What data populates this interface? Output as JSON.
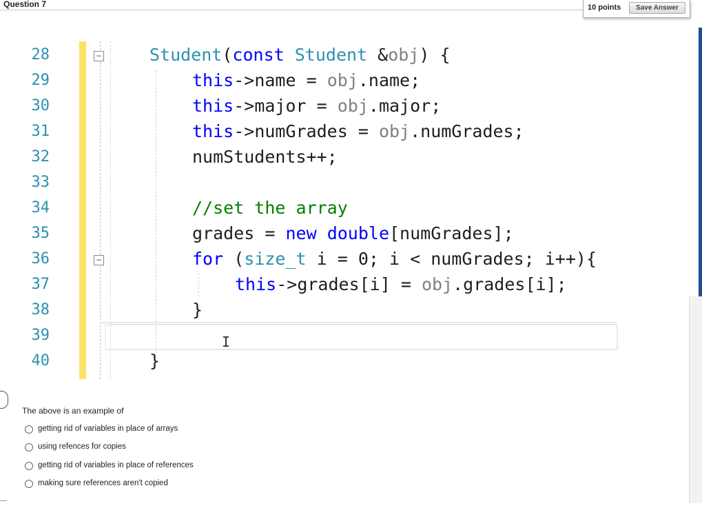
{
  "question": {
    "title": "Question 7",
    "points": "10 points",
    "save_label": "Save Answer"
  },
  "code": {
    "line_numbers": [
      "28",
      "29",
      "30",
      "31",
      "32",
      "33",
      "34",
      "35",
      "36",
      "37",
      "38",
      "39",
      "40"
    ],
    "lines": {
      "l28_a": "Student",
      "l28_b": "(",
      "l28_c": "const",
      "l28_d": " ",
      "l28_e": "Student",
      "l28_f": " &",
      "l28_g": "obj",
      "l28_h": ") {",
      "l29_a": "this",
      "l29_b": "->name = ",
      "l29_c": "obj",
      "l29_d": ".name;",
      "l30_a": "this",
      "l30_b": "->major = ",
      "l30_c": "obj",
      "l30_d": ".major;",
      "l31_a": "this",
      "l31_b": "->numGrades = ",
      "l31_c": "obj",
      "l31_d": ".numGrades;",
      "l32": "numStudents++;",
      "l34": "//set the array",
      "l35_a": "grades = ",
      "l35_b": "new",
      "l35_c": " ",
      "l35_d": "double",
      "l35_e": "[numGrades];",
      "l36_a": "for",
      "l36_b": " (",
      "l36_c": "size_t",
      "l36_d": " i = 0; i < numGrades; i++){",
      "l37_a": "this",
      "l37_b": "->grades[i] = ",
      "l37_c": "obj",
      "l37_d": ".grades[i];",
      "l38": "}",
      "l40": "}"
    },
    "fold_glyph": "−",
    "ibeam_glyph": "I"
  },
  "prompt": "The above is an example of",
  "options": [
    "getting rid of variables in place of arrays",
    "using refences for copies",
    "getting rid of variables in place of references",
    "making sure references aren't copied"
  ],
  "colors": {
    "line_number": "#2b91af",
    "keyword": "#0000ff",
    "type": "#2b91af",
    "comment": "#008000",
    "change_bar": "#fbe36a"
  }
}
